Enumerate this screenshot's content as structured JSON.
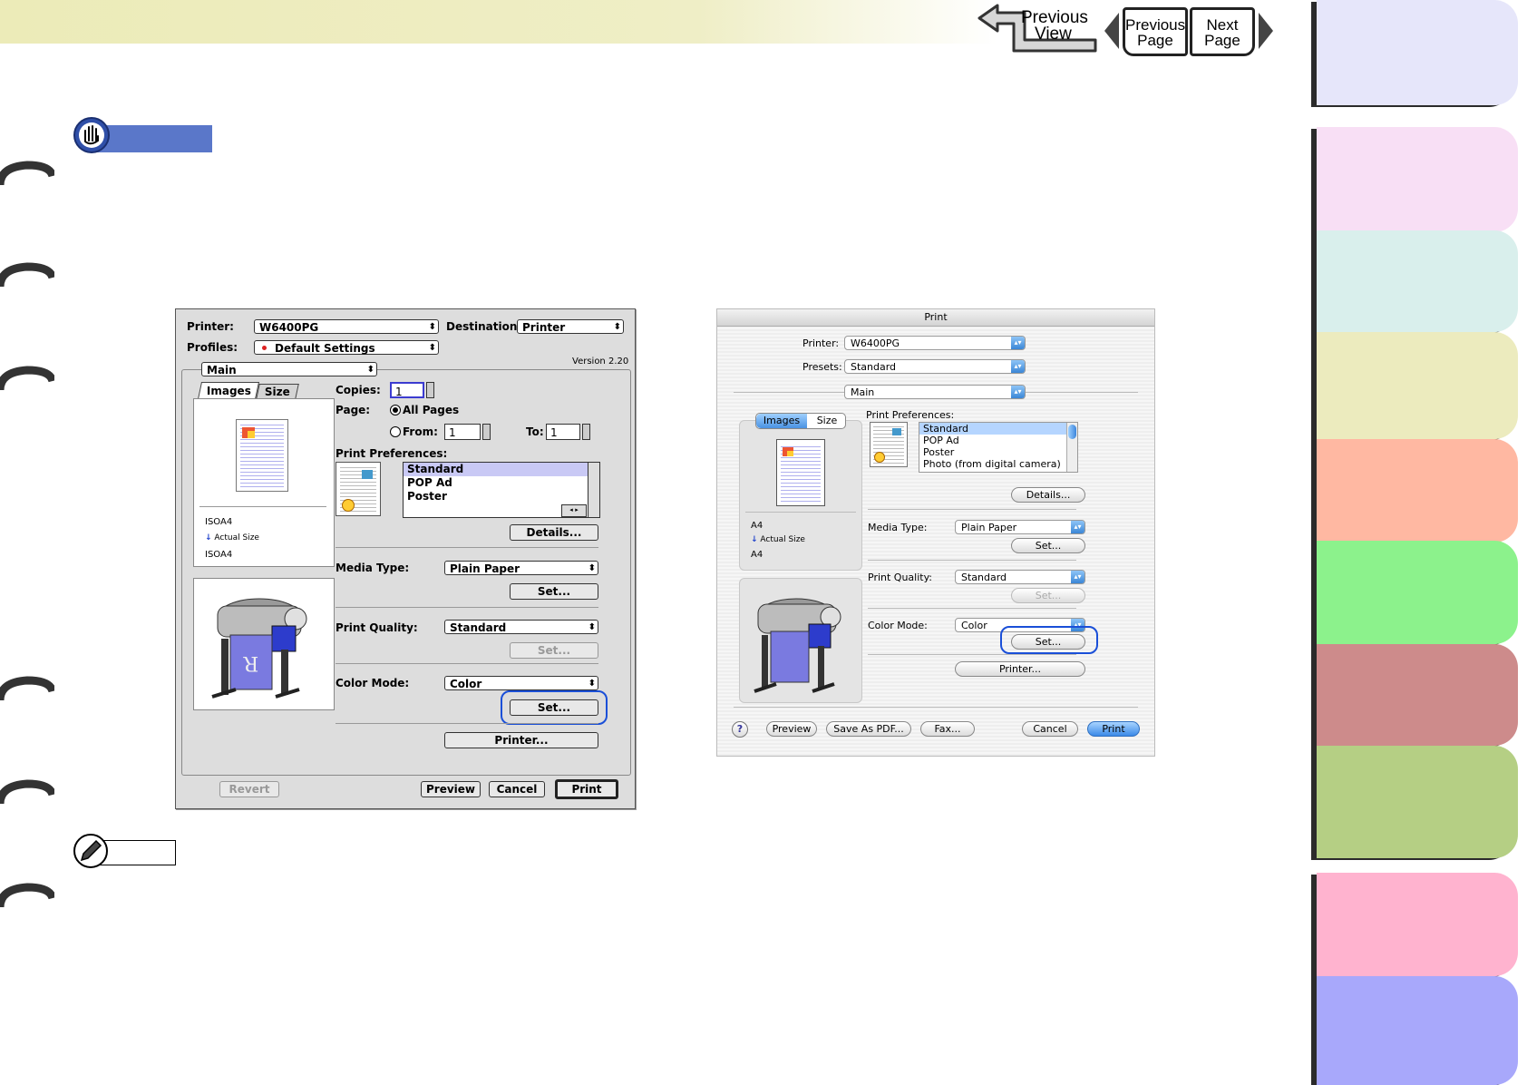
{
  "nav": {
    "previous_view": [
      "Previous",
      "View"
    ],
    "previous_page": [
      "Previous",
      "Page"
    ],
    "next_page": [
      "Next",
      "Page"
    ]
  },
  "colors": {
    "highlight": "#1a4fd8",
    "important_bar": "#5a77c9"
  },
  "icons": [
    "hand-stop-icon",
    "pencil-icon"
  ],
  "classic_dialog": {
    "printer_label": "Printer:",
    "printer_value": "W6400PG",
    "destination_label": "Destination:",
    "destination_value": "Printer",
    "profiles_label": "Profiles:",
    "profiles_value": "Default Settings",
    "version": "Version 2.20",
    "panel_value": "Main",
    "tabs": [
      "Images",
      "Size"
    ],
    "paper_in": "ISOA4",
    "scale": "Actual Size",
    "paper_out": "ISOA4",
    "copies_label": "Copies:",
    "copies_value": "1",
    "page_label": "Page:",
    "all_pages": "All Pages",
    "from_label": "From:",
    "from_value": "1",
    "to_label": "To:",
    "to_value": "1",
    "prefs_label": "Print Preferences:",
    "prefs": [
      "Standard",
      "POP Ad",
      "Poster"
    ],
    "details_button": "Details...",
    "media_label": "Media Type:",
    "media_value": "Plain Paper",
    "set_button": "Set...",
    "quality_label": "Print Quality:",
    "quality_value": "Standard",
    "color_label": "Color Mode:",
    "color_value": "Color",
    "printer_button": "Printer...",
    "revert_button": "Revert",
    "preview_button": "Preview",
    "cancel_button": "Cancel",
    "print_button": "Print"
  },
  "aqua_dialog": {
    "title": "Print",
    "printer_label": "Printer:",
    "printer_value": "W6400PG",
    "presets_label": "Presets:",
    "presets_value": "Standard",
    "panel_value": "Main",
    "tabs": [
      "Images",
      "Size"
    ],
    "paper_in": "A4",
    "scale": "Actual Size",
    "paper_out": "A4",
    "prefs_label": "Print Preferences:",
    "prefs": [
      "Standard",
      "POP Ad",
      "Poster",
      "Photo (from digital camera)"
    ],
    "details_button": "Details...",
    "media_label": "Media Type:",
    "media_value": "Plain Paper",
    "set_button": "Set...",
    "quality_label": "Print Quality:",
    "quality_value": "Standard",
    "color_label": "Color Mode:",
    "color_value": "Color",
    "printer_button": "Printer...",
    "help": "?",
    "preview_button": "Preview",
    "pdf_button": "Save As PDF...",
    "fax_button": "Fax...",
    "cancel_button": "Cancel",
    "print_button": "Print"
  },
  "side_tabs": [
    {
      "color": "#e6e6fa"
    },
    {
      "color": "#f8dff5"
    },
    {
      "color": "#d9efec"
    },
    {
      "color": "#ecebbe"
    },
    {
      "color": "#ffb8a2"
    },
    {
      "color": "#8cf28c"
    },
    {
      "color": "#cd8b8b"
    },
    {
      "color": "#b5cf84"
    },
    {
      "color": "#ffb3cf"
    },
    {
      "color": "#a8a8fb"
    }
  ]
}
